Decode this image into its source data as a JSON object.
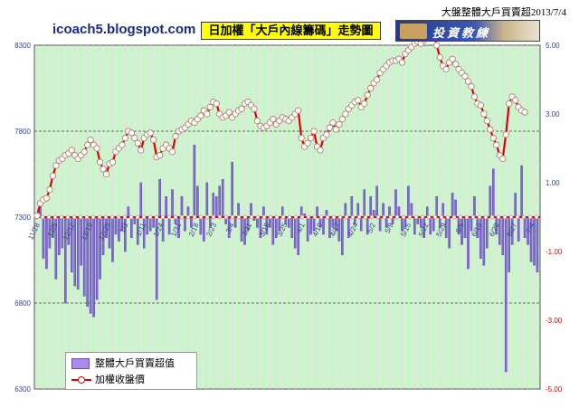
{
  "header": {
    "date_title": "大盤整體大戶買賣超2013/7/4",
    "site": "icoach5.blogspot.com",
    "chart_title": "日加權「大戶內線籌碼」走勢圖",
    "logo_text": "投資教練"
  },
  "legend": {
    "bar_label": "整體大戶買賣超值",
    "line_label": "加權收盤價"
  },
  "colors": {
    "plot_bg": "#ccf5cc",
    "line": "#e00000",
    "bar": "#8866dd",
    "bar_dark": "#4a3a9a",
    "zero_line": "#e00000",
    "title_bg": "#ffff00",
    "site_text": "#1a2a8a"
  },
  "chart_data": {
    "type": "bar+line",
    "left_axis": {
      "ticks": [
        6300,
        6800,
        7300,
        7800,
        8300
      ],
      "range": [
        6300,
        8300
      ]
    },
    "right_axis": {
      "ticks": [
        -5.0,
        -3.0,
        -1.0,
        1.0,
        3.0,
        5.0
      ],
      "range": [
        -5.0,
        5.0
      ]
    },
    "x_tick_labels": [
      "11/28",
      "12/5",
      "12/12",
      "12/19",
      "12/25",
      "1/3",
      "1/11",
      "1/24",
      "1/31",
      "2/18",
      "2/23",
      "3/4",
      "3/11",
      "3/18",
      "3/25",
      "4/1",
      "4/10",
      "4/17",
      "4/24",
      "5/2",
      "5/9",
      "5/15",
      "5/22",
      "5/29",
      "6/5",
      "6/13",
      "6/20",
      "6/27",
      "7/4"
    ],
    "grid": true,
    "legend_position": "bottom-left",
    "series": [
      {
        "name": "加權收盤價",
        "type": "line",
        "axis": "left",
        "values": [
          7308,
          7380,
          7400,
          7410,
          7460,
          7540,
          7600,
          7630,
          7640,
          7660,
          7670,
          7690,
          7660,
          7640,
          7660,
          7680,
          7720,
          7750,
          7720,
          7700,
          7620,
          7580,
          7550,
          7610,
          7620,
          7680,
          7700,
          7720,
          7760,
          7800,
          7790,
          7760,
          7730,
          7690,
          7760,
          7780,
          7790,
          7750,
          7650,
          7660,
          7700,
          7720,
          7700,
          7680,
          7770,
          7800,
          7810,
          7820,
          7840,
          7860,
          7850,
          7870,
          7890,
          7920,
          7900,
          7940,
          7970,
          7960,
          7900,
          7880,
          7890,
          7910,
          7880,
          7900,
          7920,
          7930,
          7960,
          7970,
          7950,
          7930,
          7860,
          7830,
          7820,
          7830,
          7850,
          7870,
          7840,
          7860,
          7880,
          7870,
          7860,
          7880,
          7900,
          7920,
          7760,
          7710,
          7730,
          7760,
          7800,
          7710,
          7690,
          7760,
          7780,
          7820,
          7850,
          7810,
          7840,
          7870,
          7900,
          7930,
          7950,
          7970,
          7980,
          7940,
          7960,
          8010,
          8050,
          8080,
          8100,
          8140,
          8160,
          8180,
          8200,
          8210,
          8210,
          8220,
          8200,
          8250,
          8270,
          8290,
          8310,
          8320,
          8310,
          8330,
          8350,
          8360,
          8370,
          8300,
          8230,
          8180,
          8160,
          8200,
          8220,
          8190,
          8160,
          8140,
          8120,
          8090,
          8060,
          8000,
          7960,
          7950,
          7900,
          7860,
          7810,
          7760,
          7720,
          7660,
          7640,
          7780,
          7960,
          8000,
          7980,
          7940,
          7920,
          7910
        ]
      },
      {
        "name": "整體大戶買賣超值",
        "type": "bar",
        "axis": "right",
        "values": [
          0.1,
          0.4,
          -1.2,
          -1.5,
          -0.9,
          -0.6,
          -1.8,
          -1.1,
          -0.9,
          -2.5,
          -0.8,
          -1.6,
          -2.0,
          -2.1,
          -1.4,
          -2.3,
          -2.6,
          -2.8,
          -2.9,
          -2.4,
          -1.8,
          -1.1,
          -0.6,
          -0.9,
          -1.3,
          -0.5,
          -0.7,
          -0.4,
          -1.0,
          0.3,
          -0.6,
          -0.2,
          -0.8,
          1.0,
          -0.9,
          -0.5,
          -0.4,
          -0.3,
          -2.4,
          1.1,
          -0.7,
          0.6,
          -0.5,
          0.8,
          -0.2,
          -0.6,
          0.6,
          -0.4,
          0.3,
          -0.3,
          2.1,
          0.9,
          -0.5,
          -0.7,
          1.0,
          -0.3,
          0.7,
          0.6,
          0.9,
          1.1,
          -0.2,
          -0.6,
          1.6,
          -0.3,
          0.4,
          -0.7,
          -0.8,
          -0.4,
          0.4,
          -0.1,
          -0.3,
          -0.6,
          0.3,
          -0.5,
          -0.3,
          -0.8,
          -0.6,
          -0.4,
          0.3,
          -0.2,
          -0.3,
          -0.6,
          -0.9,
          -1.1,
          0.3,
          0.1,
          -0.7,
          -0.5,
          -0.4,
          0.3,
          -0.3,
          -0.5,
          0.2,
          -0.6,
          -0.3,
          -0.4,
          -0.7,
          -1.1,
          0.4,
          -0.6,
          0.6,
          -0.2,
          0.4,
          -0.4,
          0.8,
          -0.5,
          0.6,
          0.2,
          0.9,
          -0.4,
          0.4,
          -0.3,
          0.3,
          -0.2,
          0.8,
          0.3,
          -0.4,
          -0.3,
          0.9,
          0.4,
          -0.5,
          -0.2,
          -0.3,
          -0.6,
          0.3,
          -0.5,
          -0.4,
          0.6,
          -0.3,
          0.4,
          -0.6,
          -0.9,
          0.7,
          0.5,
          -0.5,
          -0.8,
          -0.6,
          -1.5,
          -0.4,
          0.6,
          -0.6,
          -1.2,
          -1.4,
          -0.9,
          0.9,
          1.4,
          -0.5,
          -0.8,
          -1.1,
          -4.5,
          -1.6,
          -0.8,
          0.7,
          -0.7,
          1.5,
          -0.6,
          -0.8,
          -1.3,
          -1.4,
          -1.6
        ]
      }
    ]
  }
}
